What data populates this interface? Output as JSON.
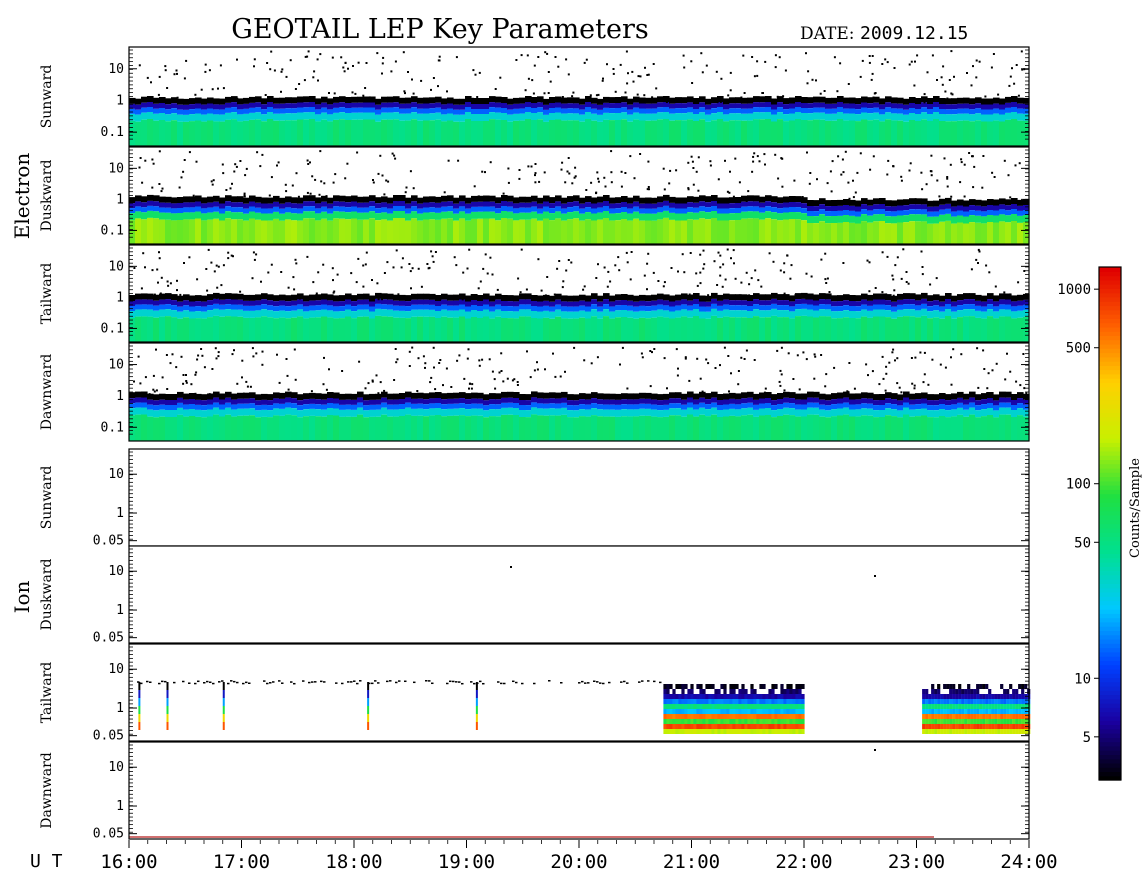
{
  "header": {
    "title": "GEOTAIL LEP Key Parameters",
    "date_label": "DATE:",
    "date_value": "2009.12.15"
  },
  "chart_data": {
    "type": "heatmap",
    "title": "GEOTAIL LEP Key Parameters",
    "x_axis": {
      "label": "U T",
      "range": [
        "16:00",
        "24:00"
      ],
      "tick_labels": [
        "16:00",
        "17:00",
        "18:00",
        "19:00",
        "20:00",
        "21:00",
        "22:00",
        "23:00",
        "24:00"
      ]
    },
    "groups": [
      {
        "name": "Electron",
        "panels": [
          {
            "name": "Sunward",
            "y_tick_labels": [
              "10",
              "1",
              "0.1"
            ],
            "y_log": true
          },
          {
            "name": "Duskward",
            "y_tick_labels": [
              "10",
              "1",
              "0.1"
            ],
            "y_log": true
          },
          {
            "name": "Tailward",
            "y_tick_labels": [
              "10",
              "1",
              "0.1"
            ],
            "y_log": true
          },
          {
            "name": "Dawnward",
            "y_tick_labels": [
              "10",
              "1",
              "0.1"
            ],
            "y_log": true
          }
        ]
      },
      {
        "name": "Ion",
        "panels": [
          {
            "name": "Sunward",
            "y_tick_labels": [
              "10",
              "1",
              "0.05"
            ],
            "y_log": true
          },
          {
            "name": "Duskward",
            "y_tick_labels": [
              "10",
              "1",
              "0.05"
            ],
            "y_log": true
          },
          {
            "name": "Tailward",
            "y_tick_labels": [
              "10",
              "1",
              "0.05"
            ],
            "y_log": true
          },
          {
            "name": "Dawnward",
            "y_tick_labels": [
              "10",
              "1",
              "0.05"
            ],
            "y_log": true
          }
        ]
      }
    ],
    "colorbar": {
      "label": "Counts/Sample",
      "scale": "log",
      "range": [
        3,
        1300
      ],
      "tick_labels": [
        "1000",
        "500",
        "100",
        "50",
        "10",
        "5"
      ],
      "tick_values": [
        1000,
        500,
        100,
        50,
        10,
        5
      ],
      "colors": [
        "#000000",
        "#1a00a0",
        "#0040ff",
        "#00c8ff",
        "#00e090",
        "#20e040",
        "#c8f000",
        "#ffd000",
        "#ff6000",
        "#e00000"
      ]
    },
    "electron_description": {
      "core_band_center_y": 0.2,
      "core_band_low_y": 0.05,
      "core_band_high_y": 0.5,
      "duskward_step_time": "22:00"
    },
    "ion_tailward_segments": [
      {
        "start": "16:05",
        "end": "16:06",
        "type": "spike"
      },
      {
        "start": "16:20",
        "end": "16:21",
        "type": "spike"
      },
      {
        "start": "16:50",
        "end": "16:51",
        "type": "spike"
      },
      {
        "start": "18:07",
        "end": "18:08",
        "type": "spike"
      },
      {
        "start": "19:05",
        "end": "19:06",
        "type": "spike"
      },
      {
        "start": "20:45",
        "end": "22:00",
        "type": "band"
      },
      {
        "start": "23:03",
        "end": "24:00",
        "type": "band"
      }
    ]
  }
}
